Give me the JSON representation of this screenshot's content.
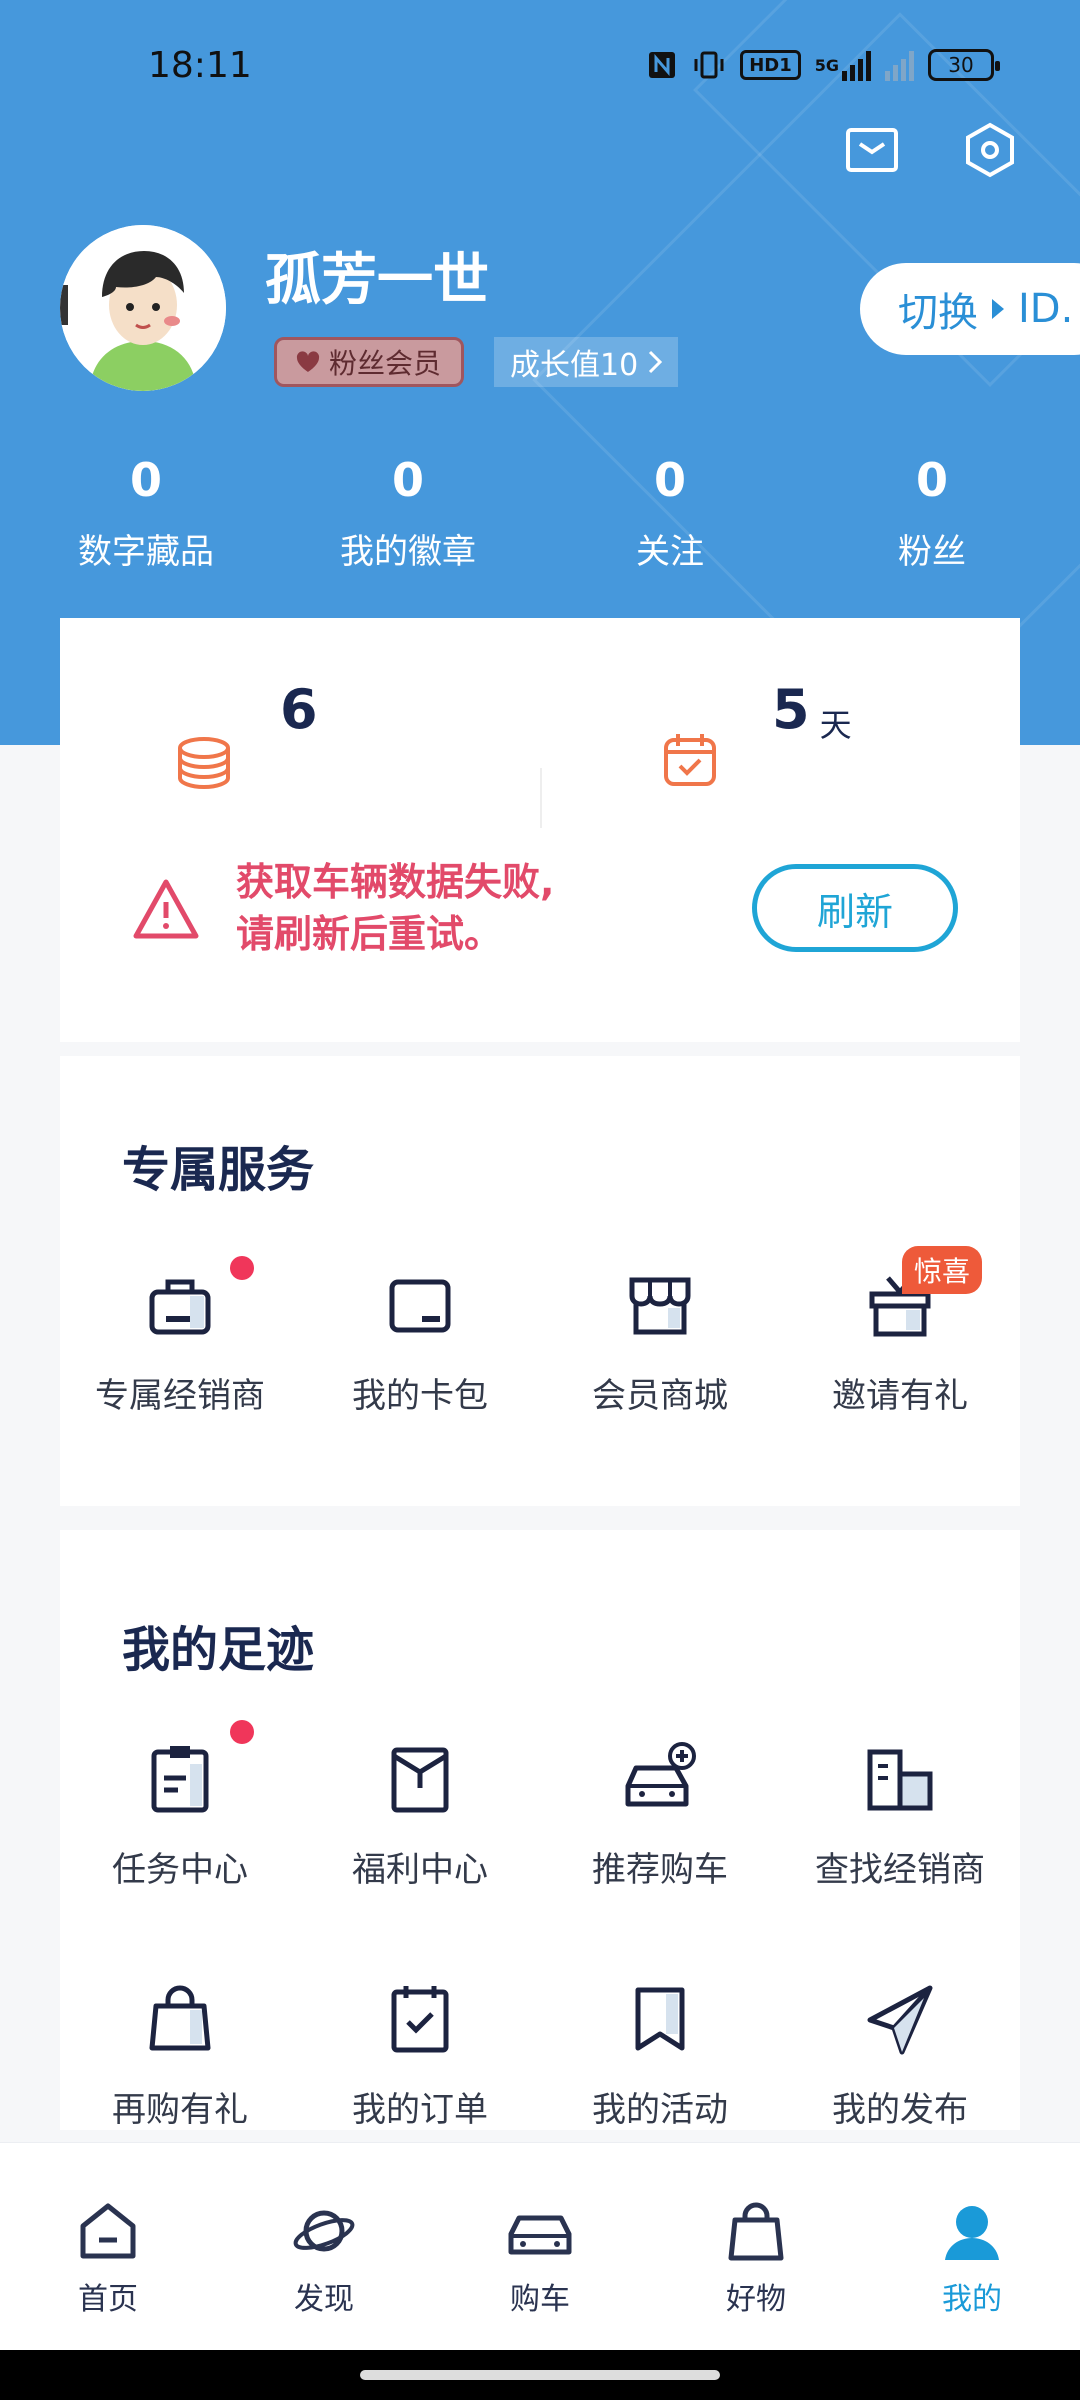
{
  "status_bar": {
    "time": "18:11",
    "network": "5G",
    "hd": "HD1",
    "battery": "30"
  },
  "profile": {
    "username": "孤芳一世",
    "fan_badge": "粉丝会员",
    "growth": "成长值10",
    "switch_label": "切换",
    "switch_brand": "ID."
  },
  "stats": [
    {
      "value": "0",
      "label": "数字藏品"
    },
    {
      "value": "0",
      "label": "我的徽章"
    },
    {
      "value": "0",
      "label": "关注"
    },
    {
      "value": "0",
      "label": "粉丝"
    }
  ],
  "points": {
    "coins": "6",
    "checkin_days": "5",
    "checkin_unit": "天"
  },
  "vehicle_error": {
    "line1": "获取车辆数据失败,",
    "line2": "请刷新后重试。",
    "refresh_label": "刷新"
  },
  "exclusive_services": {
    "title": "专属服务",
    "items": [
      {
        "label": "专属经销商",
        "icon": "briefcase-icon"
      },
      {
        "label": "我的卡包",
        "icon": "wallet-icon"
      },
      {
        "label": "会员商城",
        "icon": "store-icon"
      },
      {
        "label": "邀请有礼",
        "icon": "gift-icon"
      }
    ],
    "surprise_tag": "惊喜"
  },
  "footprints": {
    "title": "我的足迹",
    "items": [
      {
        "label": "任务中心",
        "icon": "clipboard-icon"
      },
      {
        "label": "福利中心",
        "icon": "envelope-icon"
      },
      {
        "label": "推荐购车",
        "icon": "car-plus-icon"
      },
      {
        "label": "查找经销商",
        "icon": "building-icon"
      },
      {
        "label": "再购有礼",
        "icon": "shopping-bag-icon"
      },
      {
        "label": "我的订单",
        "icon": "calendar-check-icon"
      },
      {
        "label": "我的活动",
        "icon": "bookmark-icon"
      },
      {
        "label": "我的发布",
        "icon": "send-icon"
      }
    ]
  },
  "bottom_nav": [
    {
      "label": "首页",
      "icon": "home-icon"
    },
    {
      "label": "发现",
      "icon": "planet-icon"
    },
    {
      "label": "购车",
      "icon": "car-icon"
    },
    {
      "label": "好物",
      "icon": "bag-icon"
    },
    {
      "label": "我的",
      "icon": "user-icon",
      "active": true
    }
  ],
  "colors": {
    "header": "#4698dc",
    "accent": "#1a9ad8",
    "error": "#e24a6a",
    "orange": "#f0764a"
  }
}
